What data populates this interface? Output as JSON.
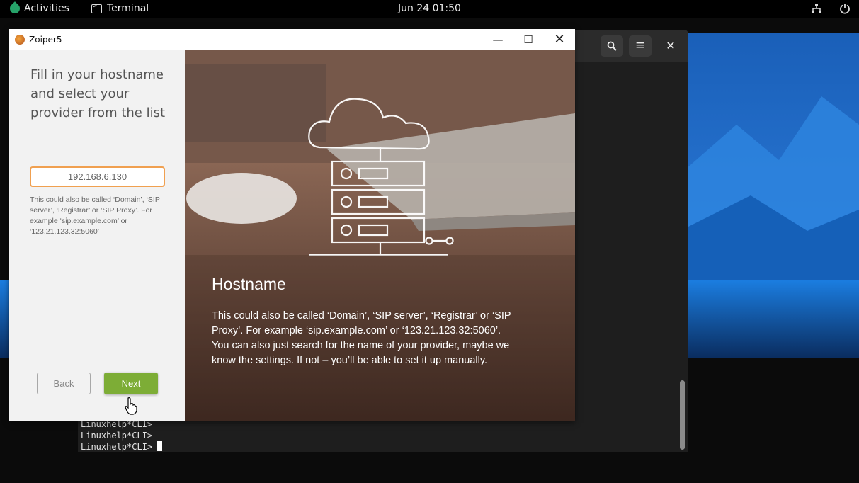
{
  "topbar": {
    "activities": "Activities",
    "app_name": "Terminal",
    "clock": "Jun 24  01:50",
    "network_icon": "network-icon",
    "power_icon": "power-icon"
  },
  "terminal": {
    "lines": [
      "Linuxhelp*CLI>",
      "Linuxhelp*CLI>",
      "Linuxhelp*CLI> "
    ],
    "search_icon": "search-icon",
    "menu_icon": "hamburger-menu-icon",
    "close_icon": "close-icon"
  },
  "zoiper": {
    "title": "Zoiper5",
    "heading": "Fill in your hostname and select your provider from the list",
    "hostname_value": "192.168.6.130",
    "hostname_help": "This could also be called ‘Domain’, ‘SIP server’, ‘Registrar’ or ‘SIP Proxy’. For example ‘sip.example.com’ or ‘123.21.123.32:5060’",
    "back_label": "Back",
    "next_label": "Next",
    "info_title": "Hostname",
    "info_body_1": " This could also be called ‘Domain’, ‘SIP server’, ‘Registrar’ or ‘SIP Proxy’. For example ‘sip.example.com’ or ‘123.21.123.32:5060’.",
    "info_body_2": "You can also just search for the name of your provider, maybe we know the settings. If not – you’ll be able to set it up manually."
  },
  "colors": {
    "accent_green": "#7dad36",
    "input_border": "#f0a050",
    "wallpaper_blue": "#1d6fd0"
  }
}
